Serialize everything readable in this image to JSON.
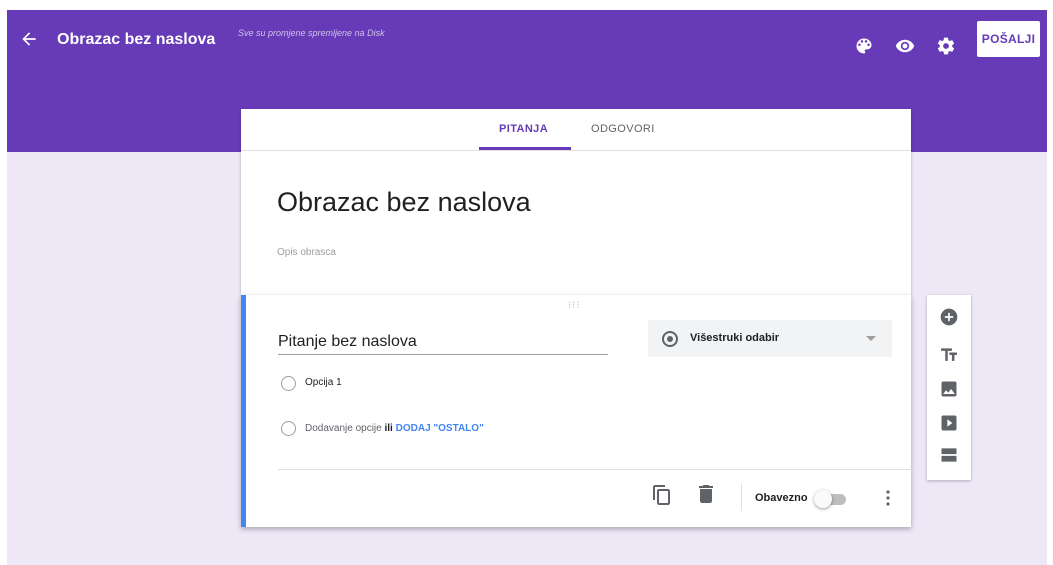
{
  "header": {
    "title": "Obrazac bez naslova",
    "save_status": "Sve su promjene spremljene na Disk",
    "send_label": "POŠALJI",
    "icons": [
      "arrow-back-icon",
      "palette-icon",
      "eye-icon",
      "gear-icon"
    ],
    "color": "#673ab7"
  },
  "tabs": [
    {
      "label": "PITANJA",
      "active": true
    },
    {
      "label": "ODGOVORI",
      "active": false
    }
  ],
  "form": {
    "title": "Obrazac bez naslova",
    "description_placeholder": "Opis obrasca"
  },
  "question": {
    "title": "Pitanje bez naslova",
    "type": "Višestruki odabir",
    "options": [
      "Opcija 1"
    ],
    "add_option_text": "Dodavanje opcije",
    "add_option_or": "ili",
    "add_other_label": "DODAJ \"OSTALO\"",
    "required_label": "Obavezno",
    "required": false,
    "accent_color": "#4285f4"
  },
  "side_toolbar": {
    "icons": [
      "add-question-icon",
      "add-title-icon",
      "add-image-icon",
      "add-video-icon",
      "add-section-icon"
    ]
  },
  "colors": {
    "background": "#ede7f6",
    "primary": "#673ab7",
    "link": "#4285f4"
  }
}
